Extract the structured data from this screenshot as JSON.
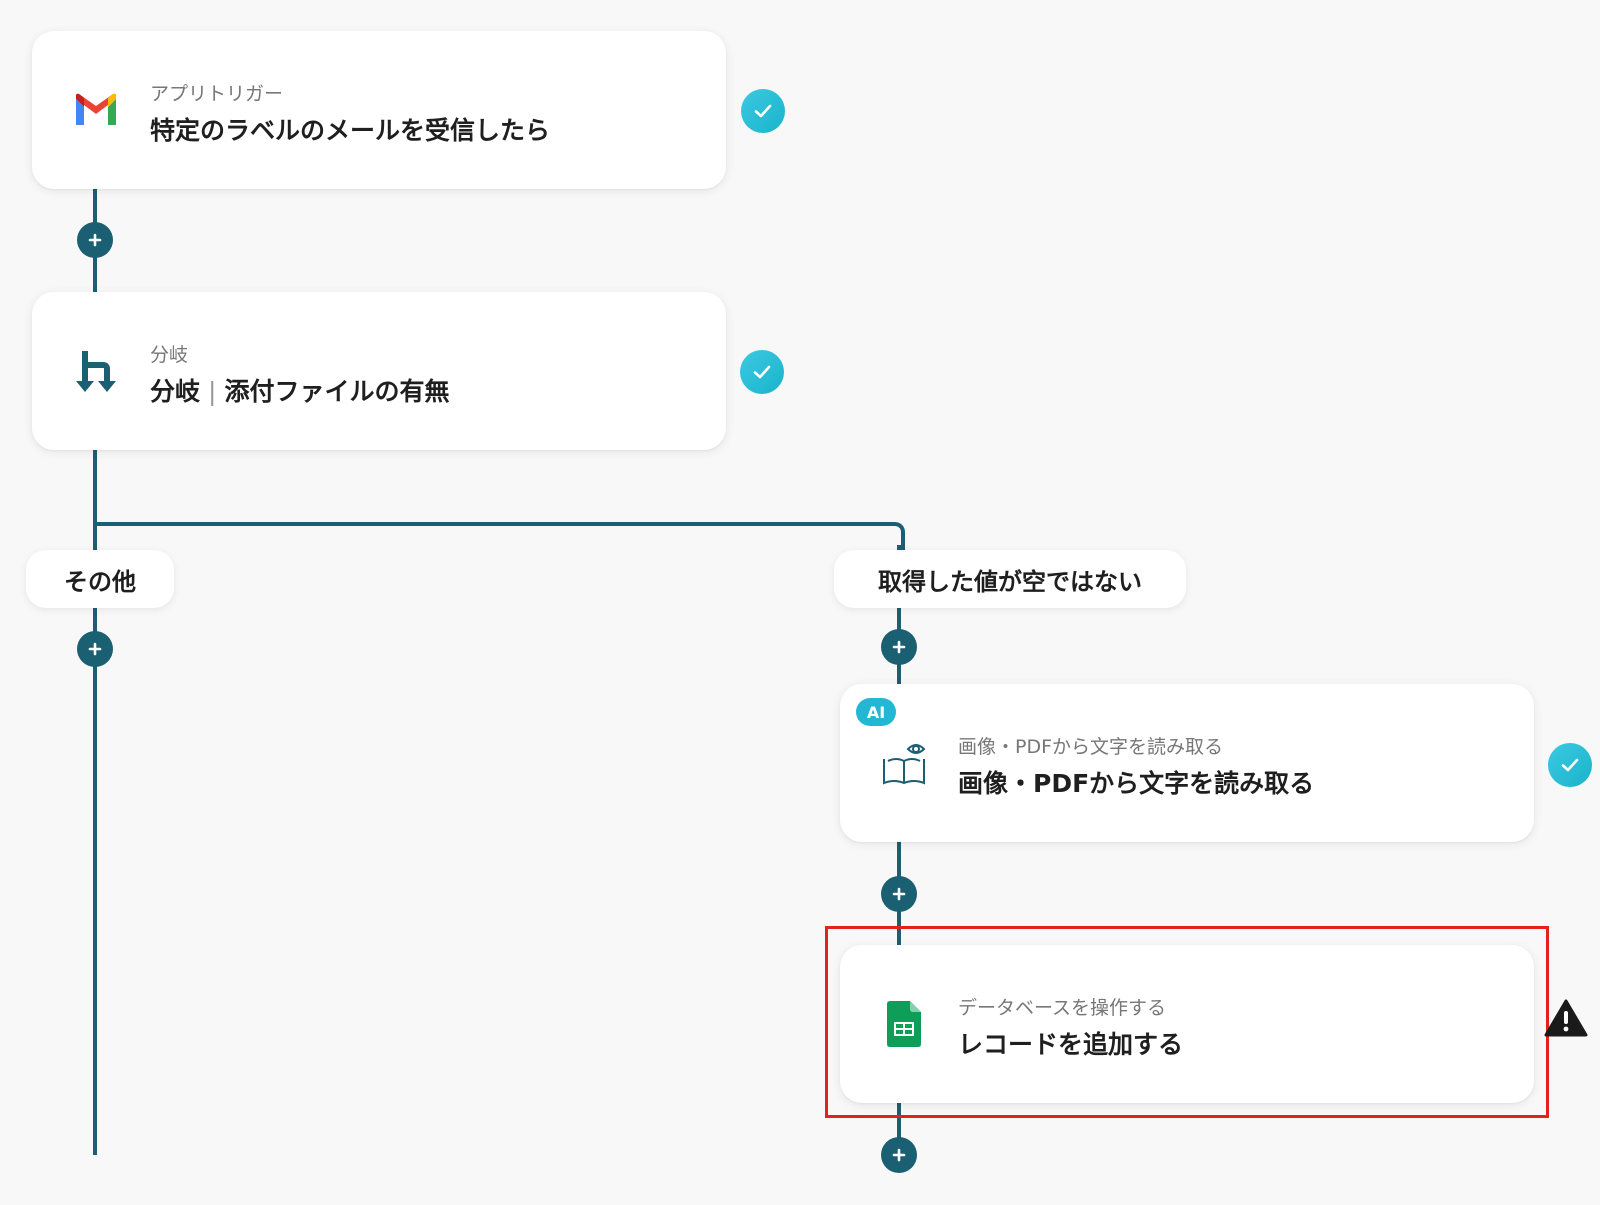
{
  "steps": {
    "trigger": {
      "subtitle": "アプリトリガー",
      "title": "特定のラベルのメールを受信したら",
      "icon": "gmail-icon",
      "status": "complete"
    },
    "branch": {
      "subtitle": "分岐",
      "title_main": "分岐",
      "title_separator": "|",
      "title_detail": "添付ファイルの有無",
      "icon": "branch-icon",
      "status": "complete"
    },
    "ocr": {
      "badge": "AI",
      "subtitle": "画像・PDFから文字を読み取る",
      "title": "画像・PDFから文字を読み取る",
      "icon": "book-eye-icon",
      "status": "complete"
    },
    "sheets": {
      "subtitle": "データベースを操作する",
      "title": "レコードを追加する",
      "icon": "google-sheets-icon",
      "status": "warning"
    }
  },
  "branches": {
    "left_label": "その他",
    "right_label": "取得した値が空ではない"
  },
  "colors": {
    "connector": "#1b5f73",
    "check": "#23b7d3",
    "highlight": "#e3231b",
    "background": "#f8f8f8"
  }
}
